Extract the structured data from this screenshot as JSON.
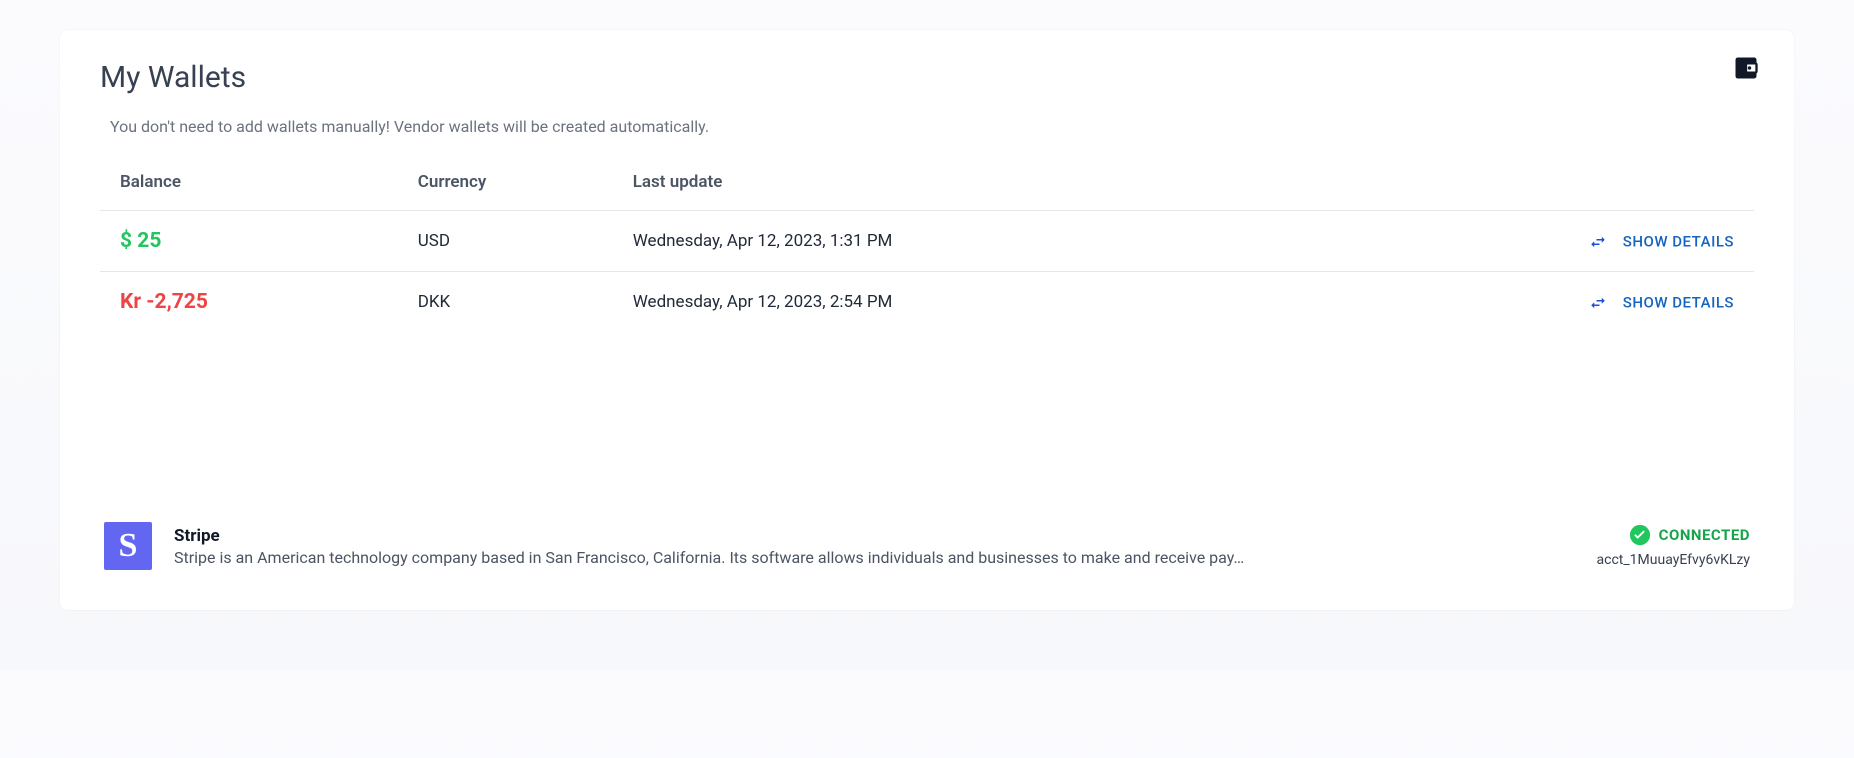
{
  "header": {
    "title": "My Wallets",
    "subtitle": "You don't need to add wallets manually! Vendor wallets will be created automatically."
  },
  "table": {
    "headers": {
      "balance": "Balance",
      "currency": "Currency",
      "last_update": "Last update"
    },
    "rows": [
      {
        "balance": "$ 25",
        "balance_sign": "pos",
        "currency": "USD",
        "last_update": "Wednesday, Apr 12, 2023, 1:31 PM",
        "action_label": "SHOW DETAILS"
      },
      {
        "balance": "Kr -2,725",
        "balance_sign": "neg",
        "currency": "DKK",
        "last_update": "Wednesday, Apr 12, 2023, 2:54 PM",
        "action_label": "SHOW DETAILS"
      }
    ]
  },
  "stripe": {
    "logo_letter": "S",
    "name": "Stripe",
    "description": "Stripe is an American technology company based in San Francisco, California. Its software allows individuals and businesses to make and receive pay…",
    "status_label": "CONNECTED",
    "account_id": "acct_1MuuayEfvy6vKLzy"
  }
}
